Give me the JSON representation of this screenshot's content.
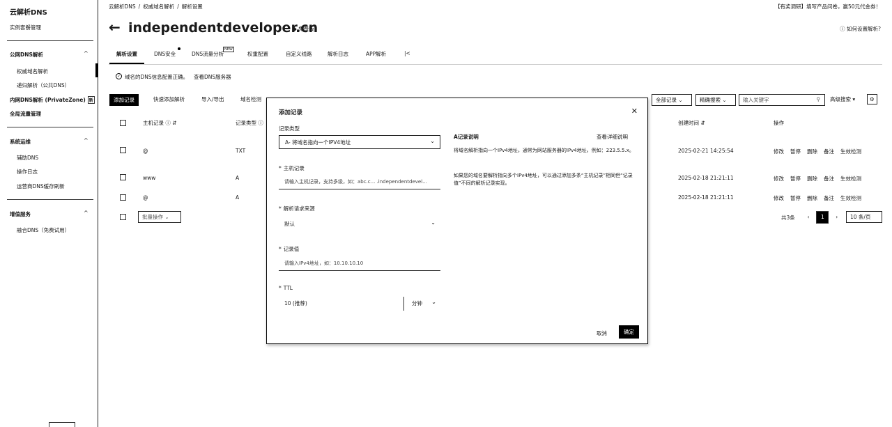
{
  "sidebar": {
    "title": "云解析DNS",
    "instance": "实例套餐管理",
    "groups": [
      {
        "label": "公网DNS解析",
        "items": [
          "权威域名解析",
          "递归解析（公共DNS）"
        ]
      },
      {
        "label": "内网DNS解析 (PrivateZone)",
        "badge": "新"
      },
      {
        "label": "全局流量管理"
      },
      {
        "label": "系统运维",
        "items": [
          "辅助DNS",
          "操作日志",
          "运营商DNS缓存刷新"
        ]
      },
      {
        "label": "增值服务",
        "items": [
          "融合DNS（免费试用）"
        ]
      }
    ]
  },
  "breadcrumb": [
    "云解析DNS",
    "权威域名解析",
    "解析设置"
  ],
  "top_notice": "【有奖调研】填写产品问卷，赢50元代金券！",
  "header": {
    "domain": "independentdeveloper.cn",
    "edition": "免费版",
    "help": "如何设置解析?"
  },
  "tabs": [
    "解析设置",
    "DNS安全",
    "DNS流量分析",
    "权重配置",
    "自定义线路",
    "解析日志",
    "APP解析",
    "|<"
  ],
  "tab_badge": "NEW",
  "info": {
    "text": "域名的DNS信息配置正确。",
    "link": "查看DNS服务器"
  },
  "toolbar": {
    "add_record": "添加记录",
    "quick_add": "快速添加解析",
    "import_export": "导入/导出",
    "domain_check": "域名检测",
    "all_records": "全部记录",
    "precise_search": "精确搜索",
    "keyword_placeholder": "输入关键字",
    "advanced_search": "高级搜索"
  },
  "table": {
    "headers": [
      "主机记录",
      "记录类型",
      "创建时间",
      "操作"
    ],
    "rows": [
      {
        "host": "@",
        "type": "TXT",
        "created": "2025-02-21 14:25:54"
      },
      {
        "host": "www",
        "type": "A",
        "created": "2025-02-18 21:21:11"
      },
      {
        "host": "@",
        "type": "A",
        "created": "2025-02-18 21:21:11"
      }
    ],
    "ops": [
      "修改",
      "暂停",
      "删除",
      "备注",
      "生效检测"
    ],
    "batch_placeholder": "批量操作"
  },
  "pagination": {
    "total": "共3条",
    "current": "1",
    "page_size": "10 条/页"
  },
  "dialog": {
    "title": "添加记录",
    "record_type_label": "记录类型",
    "record_type_value": "A- 将域名指向一个IPV4地址",
    "host_label": "主机记录",
    "host_placeholder": "请输入主机记录，支持多级，如：abc.c... .independentdevel...",
    "line_label": "解析请求来源",
    "line_value": "默认",
    "value_label": "记录值",
    "value_placeholder": "请输入IPv4地址，如：10.10.10.10",
    "ttl_label": "TTL",
    "ttl_value": "10 (推荐)",
    "ttl_unit": "分钟",
    "help_title": "A记录说明",
    "help_detail": "查看详细说明",
    "help_para1": "将域名解析指向一个IPv4地址，通常为网站服务器的IPv4地址，例如：223.5.5.x。",
    "help_para2": "如果您的域名要解析指向多个IPv4地址，可以通过添加多条“主机记录”相同但“记录值”不同的解析记录实现。",
    "cancel": "取消",
    "confirm": "确定"
  }
}
